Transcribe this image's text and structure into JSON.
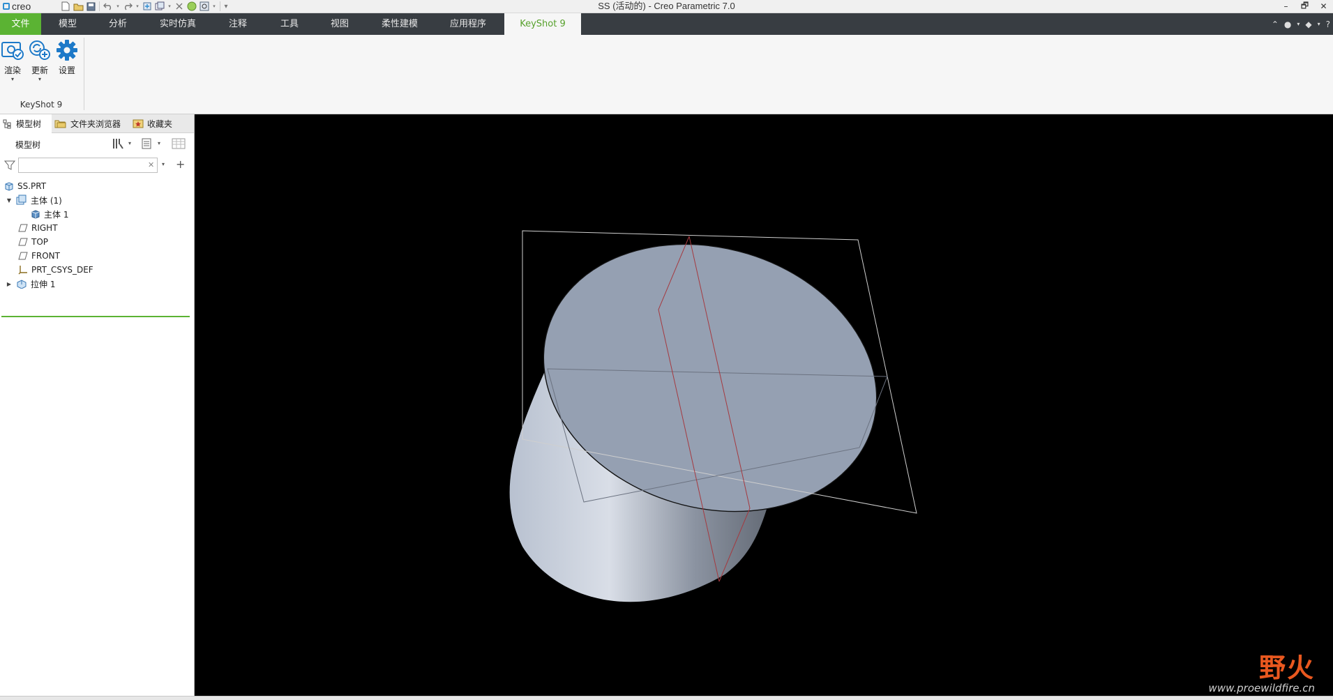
{
  "app": {
    "logo_text": "creo",
    "window_title": "SS (活动的) - Creo Parametric 7.0"
  },
  "quick_access": [
    "new-icon",
    "open-icon",
    "save-icon",
    "undo-icon",
    "redo-icon",
    "regenerate-icon",
    "windows-icon",
    "close-window-icon",
    "render-status-icon",
    "find-icon",
    "customize-icon"
  ],
  "window_controls": {
    "minimize": "–",
    "restore": "🗗",
    "close": "✕"
  },
  "ribbon": {
    "tabs": [
      {
        "label": "文件",
        "state": "file"
      },
      {
        "label": "模型",
        "state": ""
      },
      {
        "label": "分析",
        "state": ""
      },
      {
        "label": "实时仿真",
        "state": ""
      },
      {
        "label": "注释",
        "state": ""
      },
      {
        "label": "工具",
        "state": ""
      },
      {
        "label": "视图",
        "state": ""
      },
      {
        "label": "柔性建模",
        "state": ""
      },
      {
        "label": "应用程序",
        "state": ""
      },
      {
        "label": "KeyShot 9",
        "state": "active"
      }
    ],
    "buttons": {
      "render": "渲染",
      "update": "更新",
      "settings": "设置"
    },
    "group_label": "KeyShot 9"
  },
  "navigator": {
    "tabs": {
      "model_tree": "模型树",
      "folder_browser": "文件夹浏览器",
      "favorites": "收藏夹"
    },
    "header_title": "模型树",
    "search": {
      "value": "",
      "placeholder": ""
    },
    "tree": {
      "root": "SS.PRT",
      "bodies_folder": "主体 (1)",
      "body_1": "主体 1",
      "right": "RIGHT",
      "top": "TOP",
      "front": "FRONT",
      "csys": "PRT_CSYS_DEF",
      "extrude": "拉伸 1"
    }
  },
  "watermark": {
    "name": "野火",
    "url": "www.proewildfire.cn"
  },
  "colors": {
    "accent_green": "#5bb333",
    "tab_bar": "#383d42",
    "viewport_bg": "#000000",
    "model_face": "#95a0b2",
    "watermark_orange": "#e9581f"
  }
}
